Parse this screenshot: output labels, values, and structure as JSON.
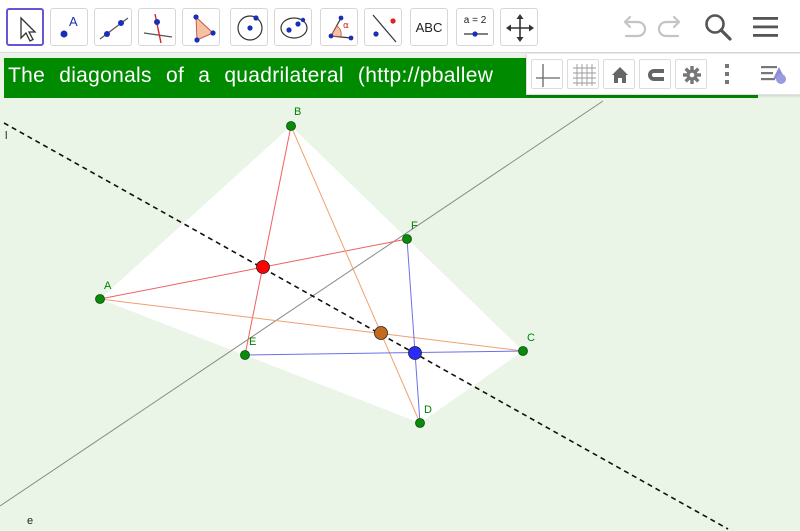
{
  "toolbar": {
    "tools": [
      {
        "name": "move-tool",
        "icon": "arrow-pointer-icon",
        "selected": true
      },
      {
        "name": "point-tool",
        "icon": "point-icon",
        "label": "A"
      },
      {
        "name": "line-tool",
        "icon": "line-through-points-icon"
      },
      {
        "name": "perpendicular-line-tool",
        "icon": "perpendicular-line-icon"
      },
      {
        "name": "polygon-tool",
        "icon": "polygon-icon"
      },
      {
        "name": "circle-tool",
        "icon": "circle-center-point-icon"
      },
      {
        "name": "conic-tool",
        "icon": "ellipse-icon"
      },
      {
        "name": "angle-tool",
        "icon": "angle-icon",
        "label": "α"
      },
      {
        "name": "reflect-tool",
        "icon": "reflect-about-line-icon"
      },
      {
        "name": "text-tool",
        "icon": "text-icon",
        "label": "ABC"
      },
      {
        "name": "slider-tool",
        "icon": "slider-icon",
        "label": "a = 2"
      },
      {
        "name": "move-graphics-view-tool",
        "icon": "move-arrows-icon"
      }
    ],
    "right_buttons": [
      "undo-icon",
      "redo-icon",
      "search-icon",
      "menu-icon"
    ]
  },
  "caption": {
    "text": "The diagonals of a quadrilateral (http://pballew"
  },
  "style_bar": {
    "buttons": [
      "axes-icon",
      "grid-icon",
      "home-icon",
      "snap-magnet-icon",
      "settings-gear-icon",
      "more-vertical-icon",
      "toggle-style-bar-icon"
    ]
  },
  "colors": {
    "point_green": "#0a8a0a",
    "midpoint_red": "#ff0000",
    "midpoint_orange": "#c46a1c",
    "midpoint_blue": "#2b2bff",
    "caption_bg": "#008a00",
    "graphics_bg": "#eaf5e8",
    "quad_fill": "#ffffff",
    "red_segment": "#ef6060",
    "orange_segment": "#f0a070",
    "blue_segment": "#6f6fe8"
  },
  "geometry": {
    "points": [
      {
        "id": "A",
        "label": "A"
      },
      {
        "id": "B",
        "label": "B"
      },
      {
        "id": "C",
        "label": "C"
      },
      {
        "id": "D",
        "label": "D"
      },
      {
        "id": "E",
        "label": "E"
      },
      {
        "id": "F",
        "label": "F"
      }
    ],
    "lines": [
      {
        "id": "l",
        "label": "l",
        "style": "dashed"
      },
      {
        "id": "e",
        "label": "e",
        "style": "solid"
      }
    ],
    "midpoints": [
      {
        "id": "M1",
        "color": "red"
      },
      {
        "id": "M2",
        "color": "orange"
      },
      {
        "id": "M3",
        "color": "blue"
      }
    ]
  }
}
